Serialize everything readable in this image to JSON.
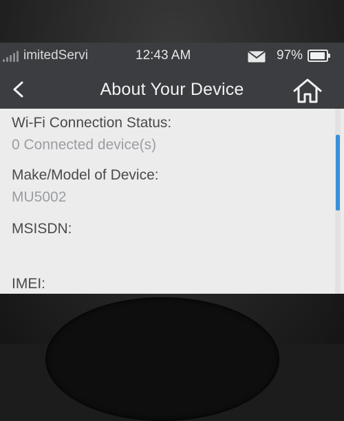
{
  "status_bar": {
    "carrier": "imitedServi",
    "time": "12:43 AM",
    "battery_percent": "97%",
    "battery_level": 0.97,
    "icons": [
      "signal-icon",
      "mail-icon",
      "battery-icon"
    ]
  },
  "header": {
    "title": "About Your Device",
    "icons": [
      "back-icon",
      "home-icon"
    ]
  },
  "fields": [
    {
      "label": "Wi-Fi Connection Status:",
      "value": "0 Connected device(s)"
    },
    {
      "label": "Make/Model of Device:",
      "value": "MU5002"
    },
    {
      "label": "MSISDN:",
      "value": ""
    },
    {
      "label": "IMEI:",
      "value": ""
    }
  ],
  "colors": {
    "bar_background": "#3b3d40",
    "scroll_thumb": "#3a8fd6",
    "label_text": "#4a4a4a",
    "value_text": "#9a9da2"
  }
}
